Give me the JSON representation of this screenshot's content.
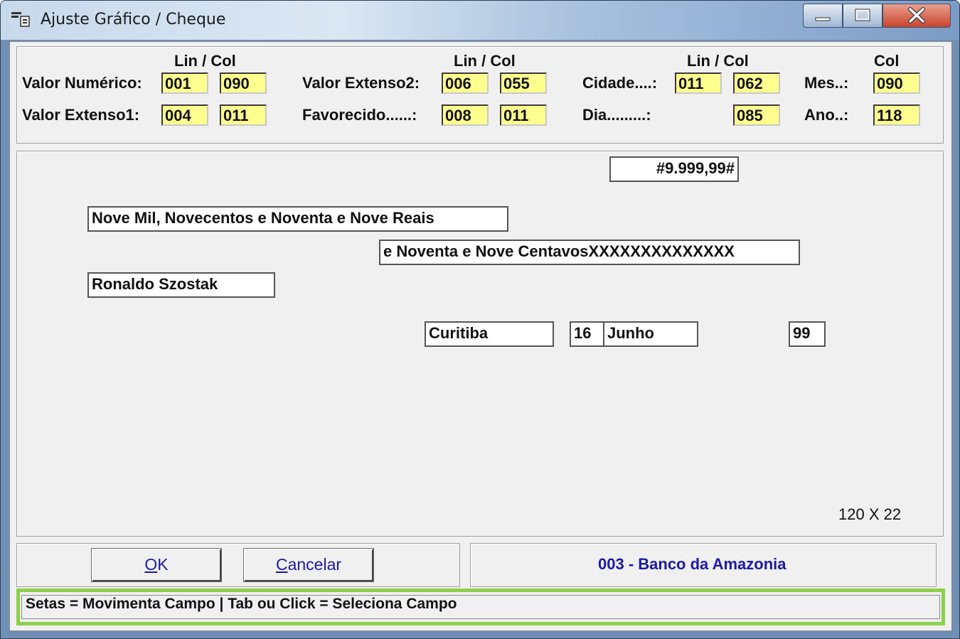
{
  "window": {
    "title": "Ajuste Gráfico / Cheque",
    "icons": {
      "app": "check-form-icon",
      "minimize": "minimize-icon",
      "maximize": "maximize-icon",
      "close": "close-icon"
    }
  },
  "positions": {
    "col_headers": {
      "group1": "Lin / Col",
      "group2": "Lin / Col",
      "group3": "Lin / Col",
      "group4": "Col"
    },
    "valor_numerico": {
      "label": "Valor Numérico:",
      "lin": "001",
      "col": "090"
    },
    "valor_extenso1": {
      "label": "Valor Extenso1:",
      "lin": "004",
      "col": "011"
    },
    "valor_extenso2": {
      "label": "Valor Extenso2:",
      "lin": "006",
      "col": "055"
    },
    "favorecido": {
      "label": "Favorecido......:",
      "lin": "008",
      "col": "011"
    },
    "cidade": {
      "label": "Cidade....:",
      "lin": "011",
      "col": "062"
    },
    "dia": {
      "label": "Dia.........:",
      "col": "085"
    },
    "mes": {
      "label": "Mes..:",
      "col": "090"
    },
    "ano": {
      "label": "Ano..:",
      "col": "118"
    }
  },
  "preview": {
    "valor_numerico": "#9.999,99#",
    "extenso1": "Nove Mil, Novecentos e Noventa e Nove Reais",
    "extenso2": "e Noventa e Nove CentavosXXXXXXXXXXXXXX",
    "favorecido": "Ronaldo Szostak",
    "cidade": "Curitiba",
    "dia": "16",
    "mes": "Junho",
    "ano": "99",
    "size": "120 X 22"
  },
  "buttons": {
    "ok": {
      "accel": "O",
      "rest": "K"
    },
    "cancelar": {
      "accel": "C",
      "rest": "ancelar"
    }
  },
  "bank": "003 - Banco da Amazonia",
  "status": "Setas = Movimenta Campo | Tab ou Click = Seleciona Campo",
  "colors": {
    "field_highlight": "#ffff90",
    "bank_text": "#1a1aa8",
    "status_border": "#8bd04b"
  }
}
